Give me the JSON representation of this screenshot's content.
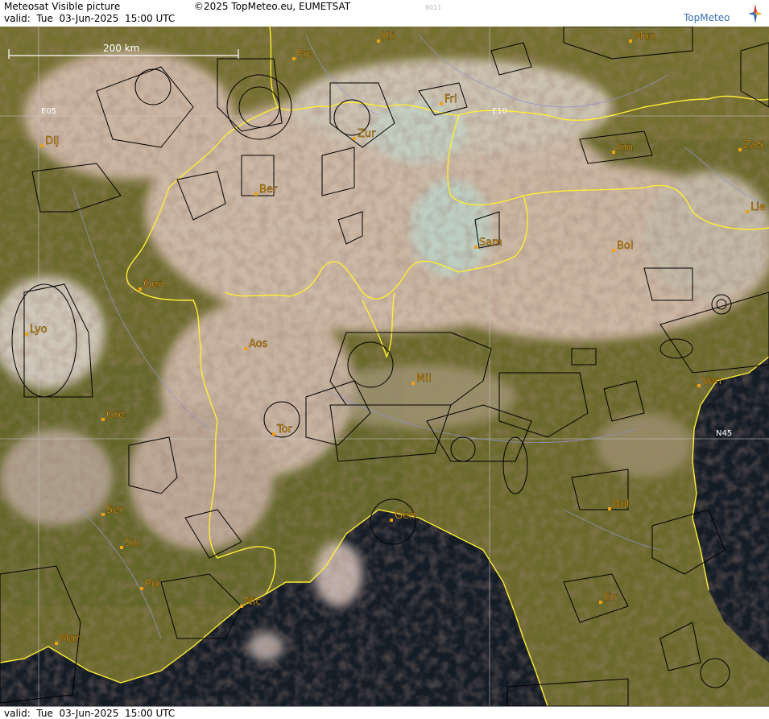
{
  "header": {
    "title": "Meteosat Visible picture",
    "valid": "valid:  Tue  03-Jun-2025  15:00 UTC",
    "copyright": "©2025 TopMeteo.eu, EUMETSAT",
    "code": "8011",
    "logo": "TopMeteo"
  },
  "footer": {
    "valid": "valid:  Tue  03-Jun-2025  15:00 UTC"
  },
  "scale_bar": {
    "label": "200 km"
  },
  "grid_labels": {
    "lon_e05": "E05",
    "lon_e10": "E10",
    "lat_n45": "N45"
  },
  "cities": [
    {
      "name": "Kli"
    },
    {
      "name": "Mun"
    },
    {
      "name": "Fre"
    },
    {
      "name": "Fri"
    },
    {
      "name": "Dij"
    },
    {
      "name": "Zur"
    },
    {
      "name": "Inn"
    },
    {
      "name": "ZaS"
    },
    {
      "name": "Ber"
    },
    {
      "name": "Lie"
    },
    {
      "name": "Sam"
    },
    {
      "name": "Bol"
    },
    {
      "name": "Gen"
    },
    {
      "name": "Lyo"
    },
    {
      "name": "Aos"
    },
    {
      "name": "Mil"
    },
    {
      "name": "Ven"
    },
    {
      "name": "Gre"
    },
    {
      "name": "Tor"
    },
    {
      "name": "Ser"
    },
    {
      "name": "Gen"
    },
    {
      "name": "Bol"
    },
    {
      "name": "Sis"
    },
    {
      "name": "Pui"
    },
    {
      "name": "Nic"
    },
    {
      "name": "Fir"
    },
    {
      "name": "Mar"
    }
  ],
  "colors": {
    "land": "#6b6a2c",
    "sea": "#141c26",
    "cloud": "#d9c3b6",
    "border": "#ffee33",
    "grid": "#c8c8c8",
    "airspace": "#000000",
    "city": "#f0a010"
  }
}
